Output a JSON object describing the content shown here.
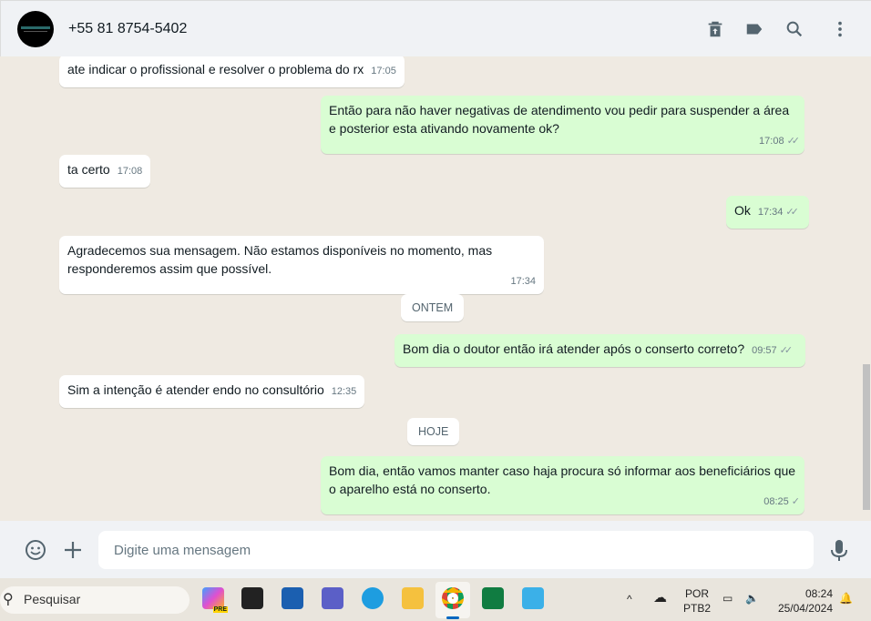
{
  "header": {
    "contact": "+55 81 8754-5402",
    "icons": [
      "archive-icon",
      "label-icon",
      "search-icon",
      "menu-icon"
    ]
  },
  "messages": [
    {
      "dir": "in",
      "text": "ate indicar o profissional e resolver o problema do rx",
      "time": "17:05"
    },
    {
      "dir": "out",
      "text": "Então para não haver negativas de atendimento vou pedir para suspender a área e posterior esta ativando novamente ok?",
      "time": "17:08",
      "status": "read"
    },
    {
      "dir": "in",
      "text": "ta certo",
      "time": "17:08"
    },
    {
      "dir": "out",
      "text": "Ok",
      "time": "17:34",
      "status": "read"
    },
    {
      "dir": "in",
      "text": "Agradecemos sua mensagem. Não estamos disponíveis no momento, mas responderemos assim que possível.",
      "time": "17:34"
    },
    {
      "dir": "out",
      "text": "Bom dia o doutor então irá atender após o conserto correto?",
      "time": "09:57",
      "status": "read"
    },
    {
      "dir": "in",
      "text": "Sim a intenção é atender endo no consultório",
      "time": "12:35"
    },
    {
      "dir": "out",
      "text": "Bom dia, então vamos manter caso haja procura só informar aos beneficiários que o aparelho está no conserto.",
      "time": "08:25",
      "status": "sent"
    }
  ],
  "dates": {
    "yesterday": "ONTEM",
    "today": "HOJE"
  },
  "input": {
    "placeholder": "Digite uma mensagem"
  },
  "taskbar": {
    "search": "Pesquisar",
    "lang1": "POR",
    "lang2": "PTB2",
    "time": "08:24",
    "date": "25/04/2024",
    "copilot_badge": "PRE"
  }
}
